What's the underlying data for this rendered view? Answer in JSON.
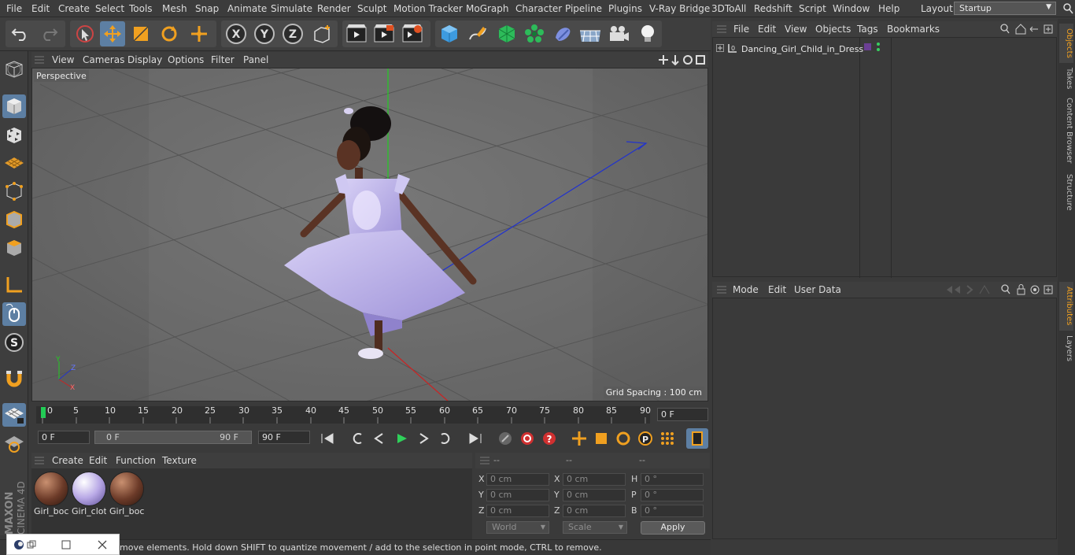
{
  "menubar": {
    "items": [
      "File",
      "Edit",
      "Create",
      "Select",
      "Tools",
      "Mesh",
      "Snap",
      "Animate",
      "Simulate",
      "Render",
      "Sculpt",
      "Motion Tracker",
      "MoGraph",
      "Character",
      "Pipeline",
      "Plugins",
      "V-Ray Bridge",
      "3DToAll",
      "Redshift",
      "Script",
      "Window",
      "Help"
    ],
    "layout_label": "Layout:",
    "layout_value": "Startup"
  },
  "viewport": {
    "menu": [
      "View",
      "Cameras",
      "Display",
      "Options",
      "Filter",
      "Panel"
    ],
    "label": "Perspective",
    "grid_spacing": "Grid Spacing : 100 cm"
  },
  "timeline": {
    "ticks": [
      "0",
      "5",
      "10",
      "15",
      "20",
      "25",
      "30",
      "35",
      "40",
      "45",
      "50",
      "55",
      "60",
      "65",
      "70",
      "75",
      "80",
      "85",
      "90"
    ],
    "current_frame": "0 F",
    "start_field": "0 F",
    "range_start": "0 F",
    "range_end": "90 F",
    "end_field": "90 F"
  },
  "materials": {
    "menu": [
      "Create",
      "Edit",
      "Function",
      "Texture"
    ],
    "items": [
      {
        "label": "Girl_boc",
        "color": "#6b3a28"
      },
      {
        "label": "Girl_clot",
        "color": "#b9a9e6"
      },
      {
        "label": "Girl_boc",
        "color": "#6b3a28"
      }
    ]
  },
  "coordinates": {
    "headers": [
      "--",
      "--",
      "--"
    ],
    "rows": [
      {
        "l1": "X",
        "v1": "0 cm",
        "l2": "X",
        "v2": "0 cm",
        "l3": "H",
        "v3": "0 °"
      },
      {
        "l1": "Y",
        "v1": "0 cm",
        "l2": "Y",
        "v2": "0 cm",
        "l3": "P",
        "v3": "0 °"
      },
      {
        "l1": "Z",
        "v1": "0 cm",
        "l2": "Z",
        "v2": "0 cm",
        "l3": "B",
        "v3": "0 °"
      }
    ],
    "world": "World",
    "scale": "Scale",
    "apply": "Apply"
  },
  "status": {
    "text": "move elements. Hold down SHIFT to quantize movement / add to the selection in point mode, CTRL to remove."
  },
  "objects": {
    "menu": [
      "File",
      "Edit",
      "View",
      "Objects",
      "Tags",
      "Bookmarks"
    ],
    "object_name": "Dancing_Girl_Child_in_Dress"
  },
  "attributes": {
    "menu": [
      "Mode",
      "Edit",
      "User Data"
    ]
  },
  "side_tabs": [
    "Objects",
    "Takes",
    "Content Browser",
    "Structure",
    "Attributes",
    "Layers"
  ],
  "colors": {
    "accent": "#5d7fa3",
    "dress": "#b8aee8",
    "skin": "#5a3324",
    "y_axis": "#22cc22",
    "z_axis": "#2233cc",
    "x_axis": "#cc2222",
    "active_tab": "#f0a020"
  },
  "logo": "MAXON CINEMA 4D"
}
